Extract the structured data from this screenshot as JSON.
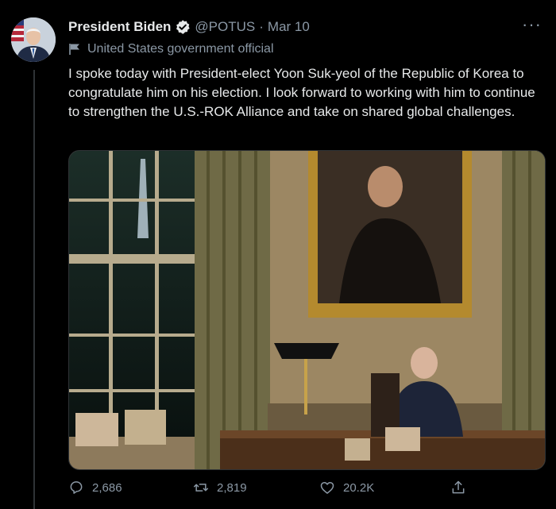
{
  "tweet": {
    "author_name": "President Biden",
    "handle": "@POTUS",
    "separator": "·",
    "date": "Mar 10",
    "label": "United States government official",
    "text": "I spoke today with President-elect Yoon Suk-yeol of the Republic of Korea to congratulate him on his election. I look forward to working with him to continue to strengthen the U.S.-ROK Alliance and take on shared global challenges."
  },
  "stats": {
    "replies": "2,686",
    "retweets": "2,819",
    "likes": "20.2K"
  },
  "icons": {
    "verified": "verified-badge-icon",
    "label": "flag-icon",
    "more": "more-icon",
    "reply": "reply-icon",
    "retweet": "retweet-icon",
    "like": "heart-icon",
    "share": "share-icon"
  },
  "colors": {
    "background": "#000000",
    "text_primary": "#e7e9ea",
    "text_secondary": "#8b98a5",
    "divider": "#2f3336"
  }
}
